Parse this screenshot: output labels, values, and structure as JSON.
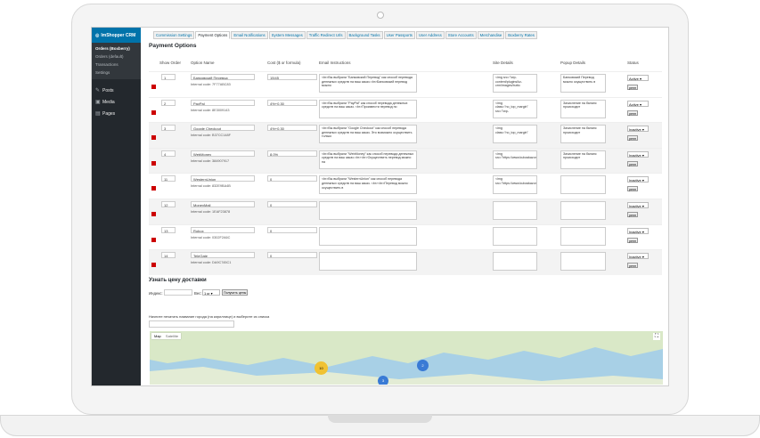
{
  "sidebar": {
    "header": "ImShopper CRM",
    "sub": [
      "Orders (Boxberry)",
      "Orders (default)",
      "Transactions",
      "Settings"
    ],
    "menu": [
      "Posts",
      "Media",
      "Pages"
    ]
  },
  "tabs": [
    "Commission Settings",
    "Payment Options",
    "Email Notifications",
    "System Messages",
    "Traffic Redirect Urls",
    "Background Tasks",
    "User Passports",
    "User Address",
    "Store Accounts",
    "Merchandise",
    "Boxberry Rates"
  ],
  "active_tab": 1,
  "page": {
    "title": "Payment Options"
  },
  "table": {
    "headers": [
      "Show Order",
      "Option Name",
      "Cost ($ or formula)",
      "Email Instructions",
      "Site Details",
      "Popup Details",
      "Status"
    ],
    "rows": [
      {
        "order": "1",
        "name": "Банковский Перевод",
        "code": "Internal code: 7F77ABC83",
        "cost": "15|45",
        "email": "<br>Вы выбрали \"Банковский Перевод\" как способ перевода денежных средств на ваш заказ.<br>Банковский перевод можно",
        "site": "<img src=\"/wp-content/plugins/kz-crm/images/butto",
        "popup": "Банковский Перевод можно осуществить в",
        "status": "Active"
      },
      {
        "order": "2",
        "name": "PayPal",
        "code": "Internal code: 8E3009143",
        "cost": "4%+0.30",
        "email": "<br>Вы выбрали \"PayPal\" как способ перевода денежных средств на ваш заказ. <br>Произвести перевод по",
        "site": "<img class=\"no_top_margin\" src=\"/wp-",
        "popup": "Зачисление на баланс происходит",
        "status": "Active"
      },
      {
        "order": "3",
        "name": "Google Checkout",
        "code": "Internal code: B37CC148F",
        "cost": "4%+0.30",
        "email": "<br>Вы выбрали \"Google Checkout\" как способ перевода денежных средств на ваш заказ. Это возможно осуществить только",
        "site": "<img class=\"no_top_margin\"",
        "popup": "Зачисление на баланс происходит",
        "status": "Inactive"
      },
      {
        "order": "4",
        "name": "WebMoney",
        "code": "Internal code: 384907917",
        "cost": "8.0%",
        "email": "<br>Вы выбрали \"WebMoney\" как способ перевода денежных средств на ваш заказ.<br><br>Осуществить перевод можно на",
        "site": "<img src=\"https://www.kubzakazon.ru/wp-",
        "popup": "Зачисление на баланс происходит",
        "status": "Inactive"
      },
      {
        "order": "11",
        "name": "WesternUnion",
        "code": "Internal code: 832E9BA4B",
        "cost": "0",
        "email": "<br>Вы выбрали \"WesternUnion\" как способ перевода денежных средств на ваш заказ. <br><br>Перевод можно осуществить в",
        "site": "<img src=\"https://www.kubzakazon.ru/wp-",
        "popup": "",
        "status": "Inactive"
      },
      {
        "order": "12",
        "name": "MoneyMail",
        "code": "Internal code: 1EAF23878",
        "cost": "0",
        "email": "",
        "site": "",
        "popup": "",
        "status": "Inactive"
      },
      {
        "order": "13",
        "name": "Robox",
        "code": "Internal code: 0302F2A6C",
        "cost": "0",
        "email": "",
        "site": "",
        "popup": "",
        "status": "Inactive"
      },
      {
        "order": "14",
        "name": "TeleGate",
        "code": "Internal code: DA9C745C1",
        "cost": "0",
        "email": "",
        "site": "",
        "popup": "",
        "status": "Inactive"
      }
    ],
    "delete_label": "perm"
  },
  "delivery": {
    "title": "Узнать цену доставки",
    "index_label": "Индекс:",
    "weight_label": "Вес:",
    "weight_value": "1 кг",
    "button": "Получить цены",
    "city_hint": "Начните печатать название города (на кириллице) и выберите из списка"
  },
  "map": {
    "type_map": "Map",
    "type_satellite": "Satellite",
    "cluster_a": "10",
    "cluster_b": "2",
    "cluster_c": "3"
  },
  "colors": {
    "sidebar": "#23282d",
    "accent": "#0073aa",
    "marker": "#cc0000"
  }
}
